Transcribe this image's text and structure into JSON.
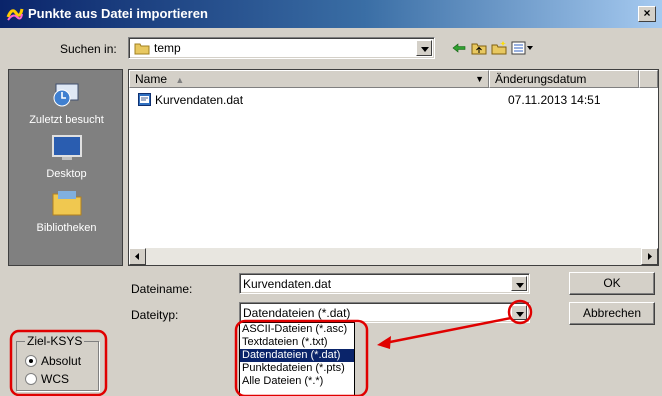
{
  "window": {
    "title": "Punkte aus Datei importieren",
    "close_glyph": "×"
  },
  "lookin": {
    "label": "Suchen in:",
    "value": "temp",
    "folder_icon": "folder-icon"
  },
  "toolbar": {
    "icons": [
      "back-icon",
      "up-folder-icon",
      "new-folder-icon",
      "view-menu-icon"
    ]
  },
  "places": [
    {
      "label": "Zuletzt besucht",
      "icon": "recent-places-icon"
    },
    {
      "label": "Desktop",
      "icon": "desktop-icon"
    },
    {
      "label": "Bibliotheken",
      "icon": "libraries-icon"
    }
  ],
  "filelist": {
    "columns": [
      "Name",
      "Änderungsdatum"
    ],
    "rows": [
      {
        "name": "Kurvendaten.dat",
        "date": "07.11.2013 14:51"
      }
    ]
  },
  "filename": {
    "label": "Dateiname:",
    "value": "Kurvendaten.dat"
  },
  "filetype": {
    "label": "Dateityp:",
    "value": "Datendateien (*.dat)",
    "options": [
      "ASCII-Dateien (*.asc)",
      "Textdateien (*.txt)",
      "Datendateien (*.dat)",
      "Punktedateien (*.pts)",
      "Alle Dateien (*.*)"
    ],
    "selected_index": 2
  },
  "buttons": {
    "ok": "OK",
    "cancel": "Abbrechen"
  },
  "target_cs": {
    "title": "Ziel-KSYS",
    "options": [
      "Absolut",
      "WCS"
    ],
    "selected": "Absolut"
  },
  "colors": {
    "annotation": "#e00000",
    "selection": "#0a246a",
    "places_bg": "#808080"
  }
}
